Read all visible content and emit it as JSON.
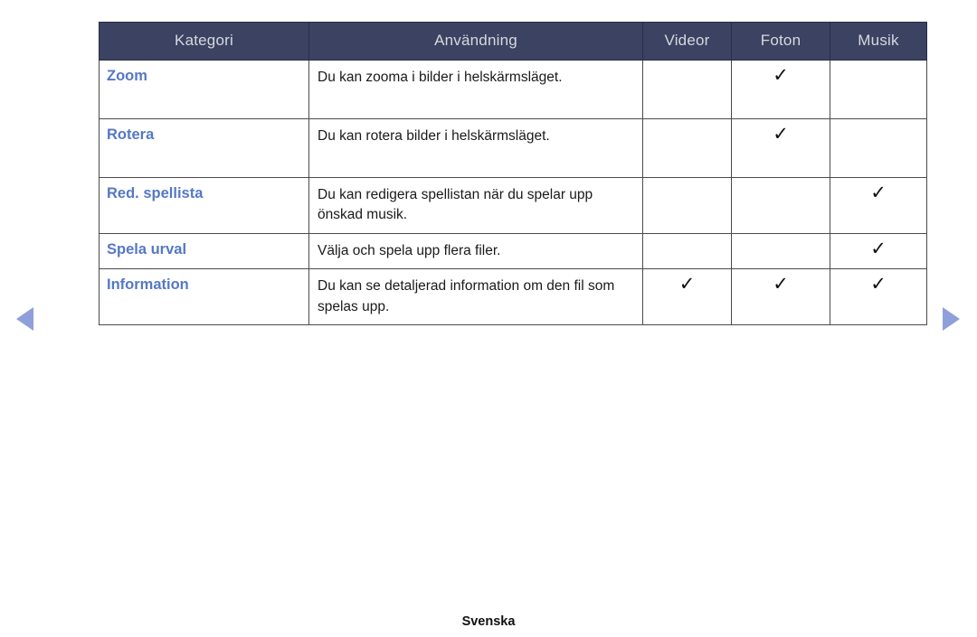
{
  "table": {
    "headers": [
      "Kategori",
      "Användning",
      "Videor",
      "Foton",
      "Musik"
    ],
    "rows": [
      {
        "category": "Zoom",
        "usage": "Du kan zooma i bilder i helskärmsläget.",
        "videor": false,
        "foton": true,
        "musik": false
      },
      {
        "category": "Rotera",
        "usage": "Du kan rotera bilder i helskärmsläget.",
        "videor": false,
        "foton": true,
        "musik": false
      },
      {
        "category": "Red. spellista",
        "usage": "Du kan redigera spellistan när du spelar upp önskad musik.",
        "videor": false,
        "foton": false,
        "musik": true
      },
      {
        "category": "Spela urval",
        "usage": "Välja och spela upp flera filer.",
        "videor": false,
        "foton": false,
        "musik": true
      },
      {
        "category": "Information",
        "usage": "Du kan se detaljerad information om den fil som spelas upp.",
        "videor": true,
        "foton": true,
        "musik": true
      }
    ],
    "check_glyph": "✓"
  },
  "nav": {
    "prev_icon": "triangle-left-icon",
    "next_icon": "triangle-right-icon"
  },
  "footer": {
    "language": "Svenska"
  },
  "colors": {
    "header_bg": "#3b4262",
    "header_text": "#d6d9de",
    "category_text": "#5578c4",
    "body_text": "#1a1a1a",
    "arrow": "#8e9fdb",
    "border": "#4a4a4a"
  }
}
